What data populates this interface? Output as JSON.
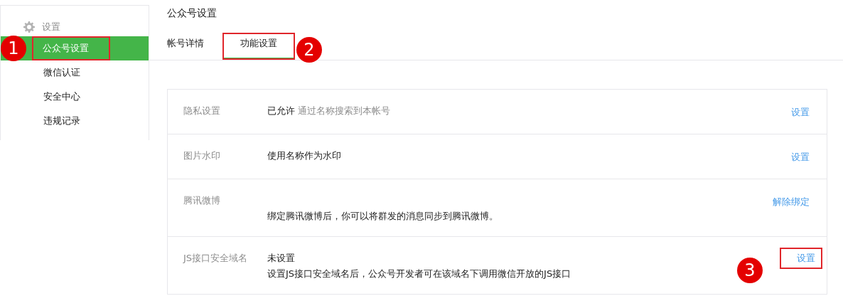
{
  "sidebar": {
    "section_title": "设置",
    "items": [
      {
        "label": "公众号设置",
        "selected": true,
        "highlighted": true,
        "badge": "1"
      },
      {
        "label": "微信认证",
        "selected": false,
        "highlighted": false
      },
      {
        "label": "安全中心",
        "selected": false,
        "highlighted": false
      },
      {
        "label": "违规记录",
        "selected": false,
        "highlighted": false
      }
    ]
  },
  "page_title": "公众号设置",
  "tabs": [
    {
      "label": "帐号详情",
      "selected": false,
      "highlighted": false
    },
    {
      "label": "功能设置",
      "selected": true,
      "highlighted": true,
      "badge": "2"
    }
  ],
  "settings": [
    {
      "label": "隐私设置",
      "value": "已允许",
      "hint": "通过名称搜索到本帐号",
      "action": {
        "label": "设置",
        "highlighted": false
      }
    },
    {
      "label": "图片水印",
      "value": "使用名称作为水印",
      "action": {
        "label": "设置",
        "highlighted": false
      }
    },
    {
      "label": "腾讯微博",
      "description": "绑定腾讯微博后，你可以将群发的消息同步到腾讯微博。",
      "action": {
        "label": "解除绑定",
        "highlighted": false
      }
    },
    {
      "label": "JS接口安全域名",
      "value": "未设置",
      "description": "设置JS接口安全域名后，公众号开发者可在该域名下调用微信开放的JS接口",
      "action": {
        "label": "设置",
        "highlighted": true,
        "badge": "3"
      }
    }
  ]
}
